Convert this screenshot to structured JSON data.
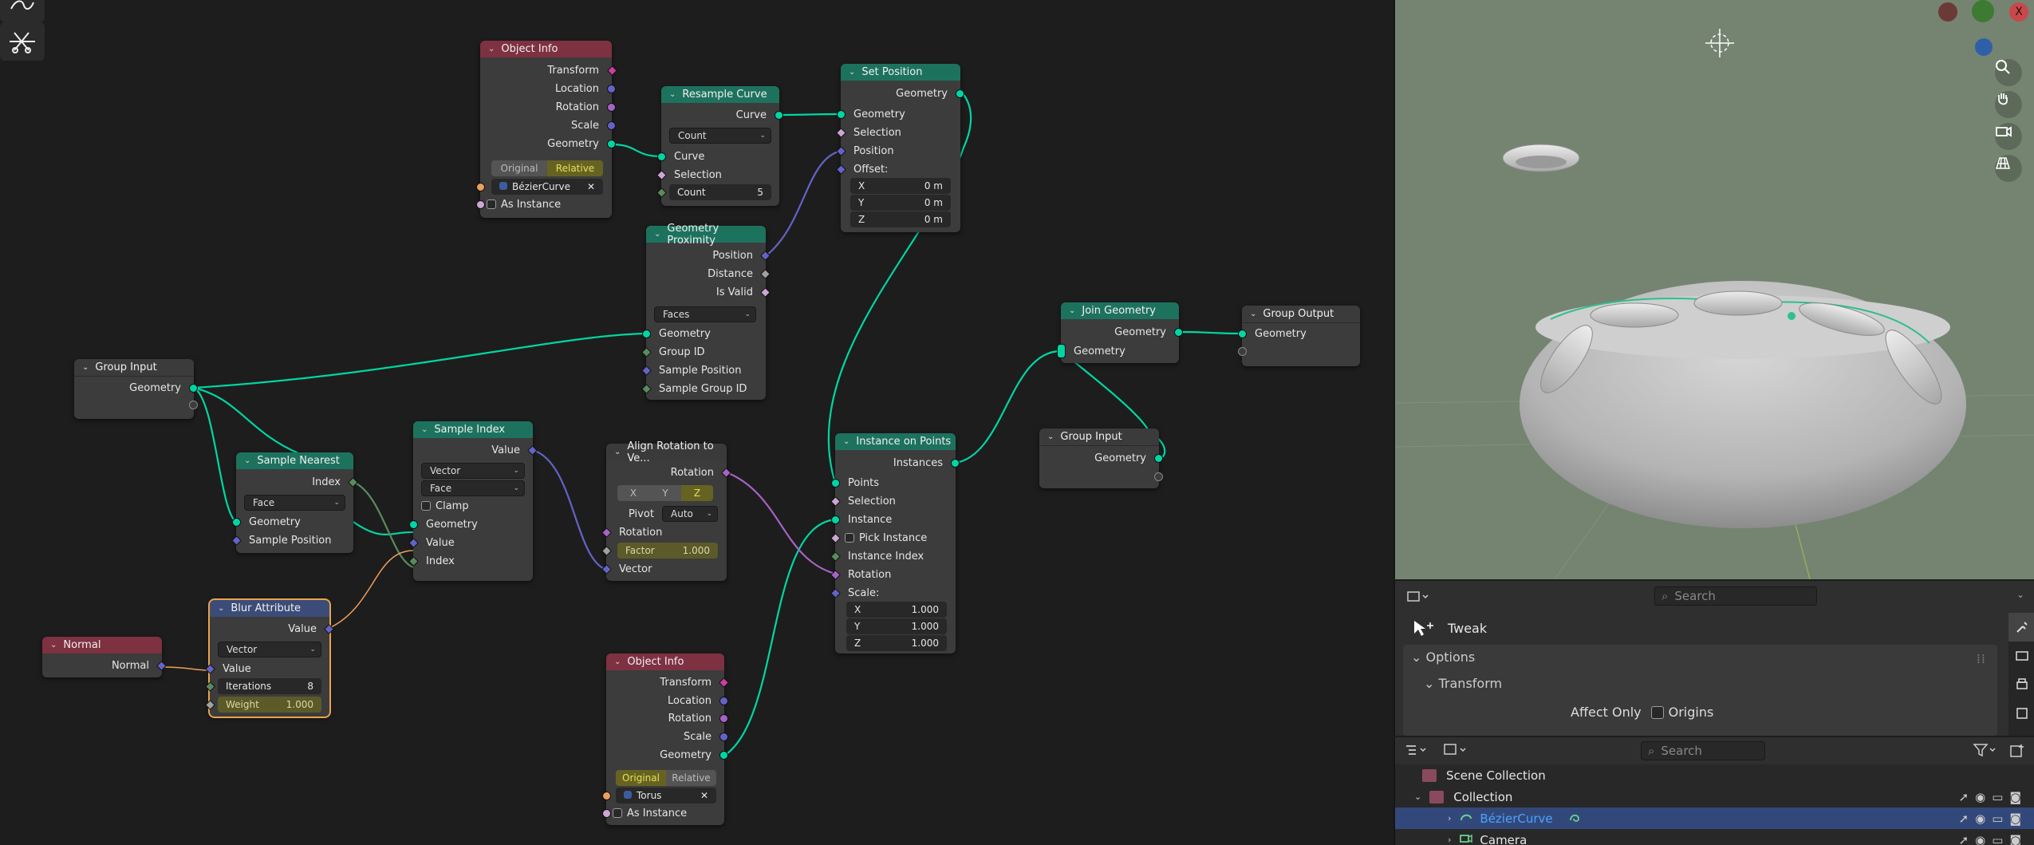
{
  "editor": {
    "tool_icons": [
      "curve-draw-icon",
      "cut-links-icon"
    ],
    "nodes": {
      "object_info_1": {
        "title": "Object Info",
        "outputs": [
          "Transform",
          "Location",
          "Rotation",
          "Scale",
          "Geometry"
        ],
        "toggle": [
          "Original",
          "Relative"
        ],
        "toggle_active": "Relative",
        "object": "BézierCurve",
        "as_instance": "As Instance"
      },
      "resample_curve": {
        "title": "Resample Curve",
        "output": "Curve",
        "mode": "Count",
        "inputs": [
          "Curve",
          "Selection"
        ],
        "count_label": "Count",
        "count_value": "5"
      },
      "set_position": {
        "title": "Set Position",
        "output": "Geometry",
        "inputs": [
          "Geometry",
          "Selection",
          "Position",
          "Offset:"
        ],
        "offset": [
          {
            "axis": "X",
            "value": "0 m"
          },
          {
            "axis": "Y",
            "value": "0 m"
          },
          {
            "axis": "Z",
            "value": "0 m"
          }
        ]
      },
      "geometry_proximity": {
        "title": "Geometry Proximity",
        "outputs": [
          "Position",
          "Distance",
          "Is Valid"
        ],
        "mode": "Faces",
        "inputs": [
          "Geometry",
          "Group ID",
          "Sample Position",
          "Sample Group ID"
        ]
      },
      "join_geometry": {
        "title": "Join Geometry",
        "output": "Geometry",
        "input": "Geometry"
      },
      "group_output": {
        "title": "Group Output",
        "input": "Geometry"
      },
      "group_input_1": {
        "title": "Group Input",
        "output": "Geometry"
      },
      "group_input_2": {
        "title": "Group Input",
        "output": "Geometry"
      },
      "sample_nearest": {
        "title": "Sample Nearest",
        "output": "Index",
        "mode": "Face",
        "inputs": [
          "Geometry",
          "Sample Position"
        ]
      },
      "sample_index": {
        "title": "Sample Index",
        "output": "Value",
        "type": "Vector",
        "domain": "Face",
        "clamp": "Clamp",
        "inputs": [
          "Geometry",
          "Value",
          "Index"
        ]
      },
      "align_rotation": {
        "title": "Align Rotation to Ve...",
        "output": "Rotation",
        "axes": [
          "X",
          "Y",
          "Z"
        ],
        "axis_active": "Z",
        "pivot_label": "Pivot",
        "pivot_value": "Auto",
        "inputs": [
          "Rotation",
          "Vector"
        ],
        "factor_label": "Factor",
        "factor_value": "1.000"
      },
      "instance_on_points": {
        "title": "Instance on Points",
        "output": "Instances",
        "inputs": [
          "Points",
          "Selection",
          "Instance",
          "Pick Instance",
          "Instance Index",
          "Rotation",
          "Scale:"
        ],
        "scale": [
          {
            "axis": "X",
            "value": "1.000"
          },
          {
            "axis": "Y",
            "value": "1.000"
          },
          {
            "axis": "Z",
            "value": "1.000"
          }
        ]
      },
      "normal": {
        "title": "Normal",
        "output": "Normal"
      },
      "blur_attribute": {
        "title": "Blur Attribute",
        "output": "Value",
        "type": "Vector",
        "input": "Value",
        "iterations_label": "Iterations",
        "iterations_value": "8",
        "weight_label": "Weight",
        "weight_value": "1.000"
      },
      "object_info_2": {
        "title": "Object Info",
        "outputs": [
          "Transform",
          "Location",
          "Rotation",
          "Scale",
          "Geometry"
        ],
        "toggle": [
          "Original",
          "Relative"
        ],
        "toggle_active": "Original",
        "object": "Torus",
        "as_instance": "As Instance"
      }
    }
  },
  "viewport": {
    "gizmo_icons": [
      "zoom-icon",
      "hand-pan-icon",
      "camera-icon",
      "grid-ortho-icon"
    ],
    "axis_labels": {
      "x": "X"
    }
  },
  "properties": {
    "search_placeholder": "Search",
    "tool_name": "Tweak",
    "options_label": "Options",
    "transform_label": "Transform",
    "affect_only_label": "Affect Only",
    "origins_label": "Origins"
  },
  "outliner": {
    "search_placeholder": "Search",
    "items": [
      {
        "label": "Scene Collection"
      },
      {
        "label": "Collection"
      },
      {
        "label": "BézierCurve"
      },
      {
        "label": "Camera"
      }
    ]
  },
  "colors": {
    "geometry_socket": "#00d6a3",
    "selected_row": "#33487a",
    "accent_blue": "#4aa3ff"
  }
}
